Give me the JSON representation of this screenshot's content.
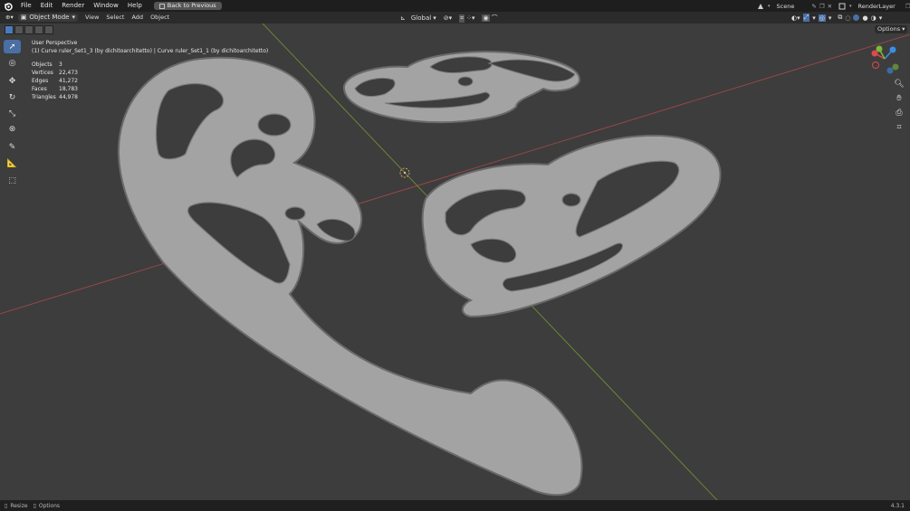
{
  "topbar": {
    "menus": [
      "File",
      "Edit",
      "Render",
      "Window",
      "Help"
    ],
    "back_button": "Back to Previous",
    "scene": "Scene",
    "render_layer": "RenderLayer"
  },
  "header": {
    "mode": "Object Mode",
    "menus": [
      "View",
      "Select",
      "Add",
      "Object"
    ],
    "orientation": "Global",
    "options": "Options"
  },
  "viewport": {
    "perspective": "User Perspective",
    "selection": "(1) Curve ruler_Set1_3 (by dichitoarchitetto) | Curve ruler_Set1_1 (by dichitoarchitetto)",
    "stats": [
      {
        "label": "Objects",
        "value": "3"
      },
      {
        "label": "Vertices",
        "value": "22,473"
      },
      {
        "label": "Edges",
        "value": "41,272"
      },
      {
        "label": "Faces",
        "value": "18,783"
      },
      {
        "label": "Triangles",
        "value": "44,978"
      }
    ]
  },
  "statusbar": {
    "left1": "Resize",
    "left2": "Options",
    "version": "4.3.1"
  },
  "colors": {
    "topbar_bg": "#1e1e1e",
    "viewport_bg": "#3d3d3d",
    "active_tool": "#4a6fa5",
    "x_axis": "#b04a4a",
    "y_axis": "#7a9a3a",
    "ruler": "#a3a3a3",
    "gizmo_x": "#e0484d",
    "gizmo_y": "#7cb93a",
    "gizmo_z": "#3a8ee6"
  }
}
